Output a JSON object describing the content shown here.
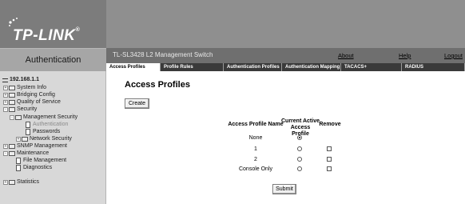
{
  "brand": {
    "name": "TP-LINK",
    "tm": "®"
  },
  "left_title": "Authentication",
  "switch_title": "TL-SL3428 L2 Management Switch",
  "top_links": {
    "about": "About",
    "help": "Help",
    "logout": "Logout"
  },
  "tabs": [
    "Access Profiles",
    "Profile Rules",
    "Authentication Profiles",
    "Authentication Mapping",
    "TACACS+",
    "RADIUS"
  ],
  "active_tab": 0,
  "sidebar": {
    "root": "192.168.1.1",
    "items": [
      {
        "label": "System Info",
        "expander": "+"
      },
      {
        "label": "Bridging Config",
        "expander": "+"
      },
      {
        "label": "Quality of Service",
        "expander": "+"
      },
      {
        "label": "Security",
        "expander": "-"
      },
      {
        "label": "Management Security",
        "expander": "-"
      },
      {
        "label": "Authentication"
      },
      {
        "label": "Passwords"
      },
      {
        "label": "Network Security",
        "expander": "+"
      },
      {
        "label": "SNMP Management",
        "expander": "+"
      },
      {
        "label": "Maintenance",
        "expander": "-"
      },
      {
        "label": "File Management"
      },
      {
        "label": "Diagnostics"
      },
      {
        "label": "Statistics",
        "expander": "+"
      }
    ]
  },
  "main": {
    "title": "Access Profiles",
    "create_label": "Create",
    "submit_label": "Submit",
    "table": {
      "headers": [
        "Access Profile Name",
        "Current Active Access Profile",
        "Remove"
      ],
      "rows": [
        {
          "name": "None",
          "active": true,
          "removable": false
        },
        {
          "name": "1",
          "active": false,
          "removable": true
        },
        {
          "name": "2",
          "active": false,
          "removable": true
        },
        {
          "name": "Console Only",
          "active": false,
          "removable": true
        }
      ]
    }
  },
  "colors": {
    "header_bg": "#8f8f8f",
    "tab_bg": "#3a3a3a",
    "sidebar_bg": "#d8d8d8"
  }
}
